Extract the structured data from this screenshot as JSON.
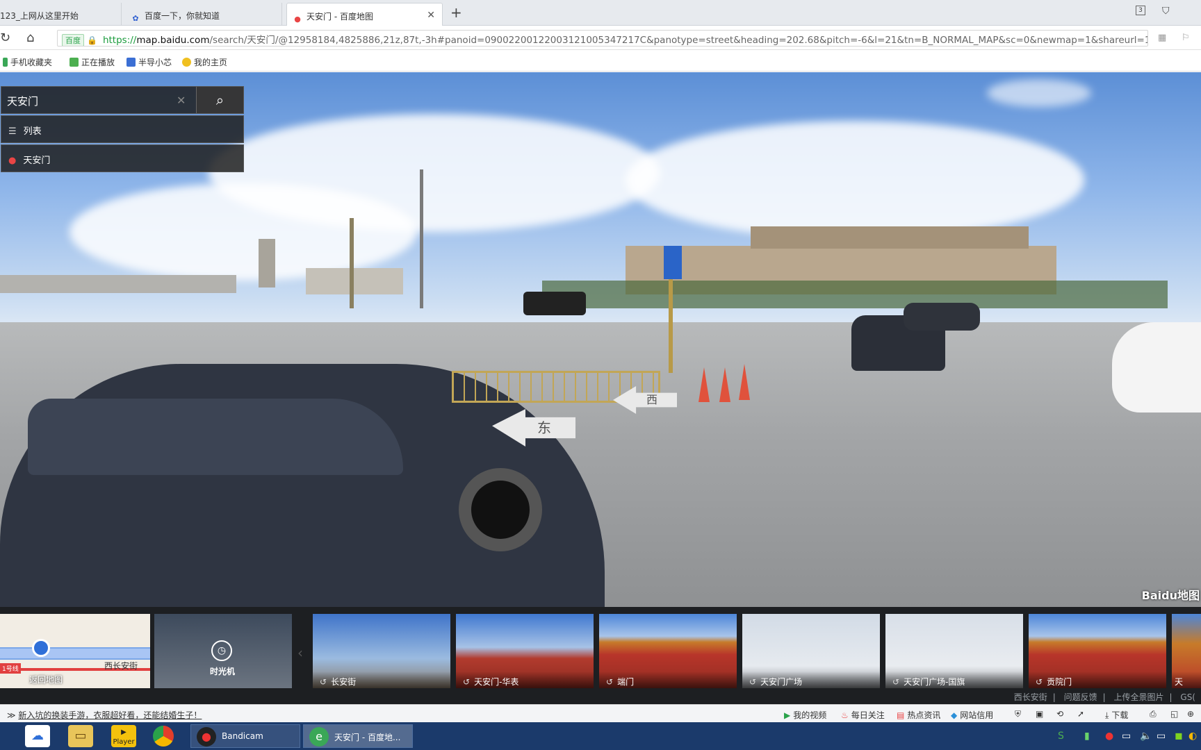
{
  "tabs": [
    {
      "title": "123_上网从这里开始"
    },
    {
      "title": "百度一下，你就知道"
    },
    {
      "title": "天安门 - 百度地图"
    }
  ],
  "window_badge": "3",
  "address": {
    "cert_label": "百度",
    "scheme": "https://",
    "host": "map.baidu.com",
    "path": "/search/天安门/@12958184,4825886,21z,87t,-3h#panoid=09002200122003121005347217C&panotype=street&heading=202.68&pitch=-6&l=21&tn=B_NORMAL_MAP&sc=0&newmap=1&shareurl=1&"
  },
  "bookmarks": [
    "手机收藏夹",
    "正在播放",
    "半导小芯",
    "我的主页"
  ],
  "search": {
    "value": "天安门",
    "list_label": "列表",
    "result_label": "天安门"
  },
  "pano_brand": "Baidu地图",
  "road_marks": [
    "东",
    "西"
  ],
  "thumbnails": [
    {
      "label": "返回地图",
      "street": "西长安街",
      "line_badge": "1号线"
    },
    {
      "label": "时光机"
    },
    {
      "label": "长安街"
    },
    {
      "label": "天安门-华表"
    },
    {
      "label": "端门"
    },
    {
      "label": "天安门广场"
    },
    {
      "label": "天安门广场-国旗"
    },
    {
      "label": "贡院门"
    },
    {
      "label": "天"
    }
  ],
  "footer_links": [
    "西长安街",
    "问题反馈",
    "上传全景图片",
    "GS("
  ],
  "statusbar": {
    "news": "新入坑的换装手游，衣服超好看，还能结婚生子！",
    "items": [
      "我的视频",
      "每日关注",
      "热点资讯",
      "网站信用",
      "下载"
    ]
  },
  "taskbar": {
    "tasks": [
      {
        "label": "Bandicam"
      },
      {
        "label": "天安门 - 百度地..."
      }
    ],
    "player_label": "Player"
  },
  "colors": {
    "tab_bg": "#e7eaee",
    "pano_sky": "#8fb6ea",
    "panel_bg": "#1e1e1e",
    "pin_red": "#e94545",
    "url_green": "#1a9b3c",
    "taskbar": "#1b3a6b"
  }
}
